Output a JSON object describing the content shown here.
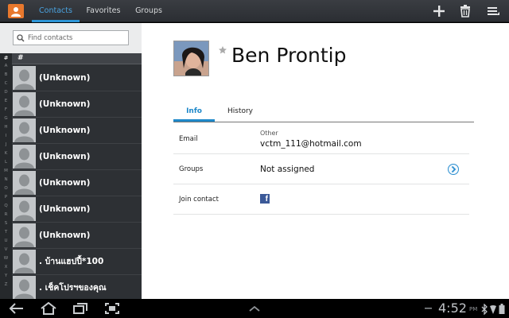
{
  "actionbar": {
    "tabs": [
      "Contacts",
      "Favorites",
      "Groups"
    ],
    "icons": [
      "contacts-app-icon",
      "plus-icon",
      "trash-icon",
      "menu-icon"
    ]
  },
  "search": {
    "placeholder": "Find contacts"
  },
  "index": {
    "header": "#",
    "letters": [
      "#",
      "A",
      "B",
      "C",
      "D",
      "E",
      "F",
      "G",
      "H",
      "I",
      "J",
      "K",
      "L",
      "M",
      "N",
      "O",
      "P",
      "Q",
      "R",
      "S",
      "T",
      "U",
      "V",
      "W",
      "X",
      "Y",
      "Z"
    ]
  },
  "contacts": [
    {
      "name": "(Unknown)"
    },
    {
      "name": "(Unknown)"
    },
    {
      "name": "(Unknown)"
    },
    {
      "name": "(Unknown)"
    },
    {
      "name": "(Unknown)"
    },
    {
      "name": "(Unknown)"
    },
    {
      "name": "(Unknown)"
    },
    {
      "name": ". บ้านแฮปปี้*100"
    },
    {
      "name": ". เช็คโปรฯของคุณ"
    }
  ],
  "detail": {
    "name": "Ben Prontip",
    "tabs": [
      "Info",
      "History"
    ],
    "fields": [
      {
        "label": "Email",
        "sub": "Other",
        "value": "vctm_111@hotmail.com"
      },
      {
        "label": "Groups",
        "value": "Not assigned"
      },
      {
        "label": "Join contact"
      }
    ]
  },
  "status": {
    "time": "4:52",
    "ampm": "PM"
  },
  "colors": {
    "accent": "#2c94d6",
    "actionbar": "#2f3237",
    "left_bg": "#2d3034",
    "facebook": "#3b5998"
  }
}
